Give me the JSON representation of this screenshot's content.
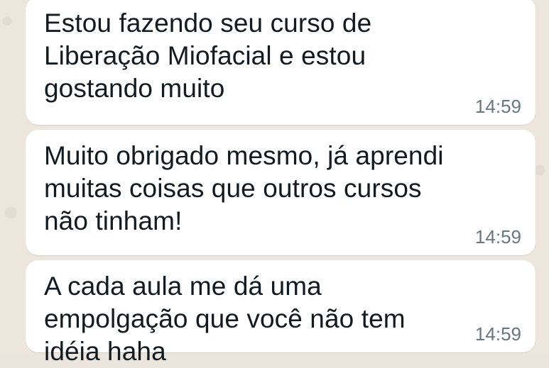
{
  "messages": [
    {
      "text": "Estou fazendo seu curso de Liberação Miofacial e estou gostando muito",
      "time": "14:59"
    },
    {
      "text": "Muito obrigado mesmo, já aprendi muitas coisas que outros cursos não tinham!",
      "time": "14:59"
    },
    {
      "text": "A cada aula me dá uma empolgação que você não tem idéia haha",
      "time": "14:59"
    }
  ]
}
